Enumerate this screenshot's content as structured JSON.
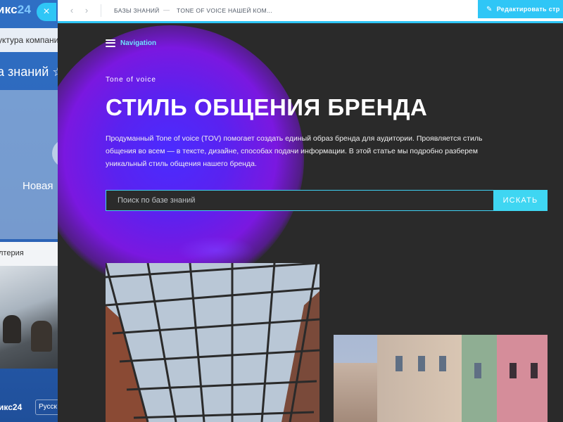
{
  "background_app": {
    "logo_text": "икс",
    "logo_num": "24",
    "close_glyph": "×",
    "structure_label": "уктура компании",
    "section_heading": "а знаний ☆",
    "card_label": "Новая",
    "list_label": "лтерия",
    "footer_logo": "икс24",
    "footer_lang": "Русск"
  },
  "topbar": {
    "back_glyph": "‹",
    "forward_glyph": "›",
    "breadcrumbs": [
      "Базы знаний",
      "Tone of voice нашей ком..."
    ],
    "crumb_separator": "—",
    "edit_button_label": "Редактировать стр"
  },
  "page": {
    "nav_label": "Navigation",
    "eyebrow": "Tone of voice",
    "title": "СТИЛЬ ОБЩЕНИЯ БРЕНДА",
    "description": "Продуманный Tone of voice (TOV) помогает создать единый образ бренда для аудитории. Проявляется стиль общения во всем — в тексте, дизайне, способах подачи информации. В этой статье мы подробно разберем уникальный стиль общения нашего бренда.",
    "search_placeholder": "Поиск по базе знаний",
    "search_button": "ИСКАТЬ"
  },
  "colors": {
    "accent": "#2fc6f6",
    "background_dark": "#2a2a2a",
    "glow": "#5a22f0"
  },
  "icons": {
    "menu": "hamburger-icon",
    "edit": "pencil-icon",
    "close": "close-icon"
  }
}
